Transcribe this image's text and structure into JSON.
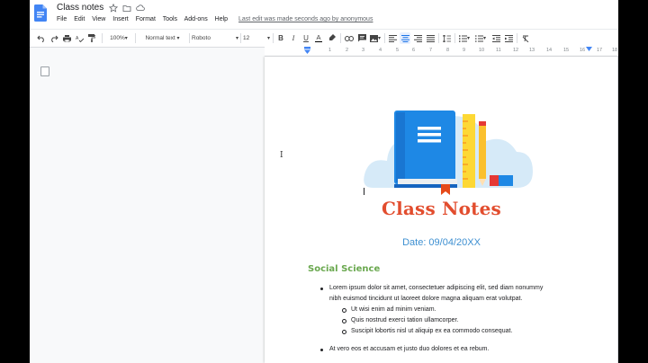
{
  "app": {
    "title": "Class notes",
    "menus": [
      "File",
      "Edit",
      "View",
      "Insert",
      "Format",
      "Tools",
      "Add-ons",
      "Help"
    ],
    "last_edit": "Last edit was made seconds ago by anonymous"
  },
  "toolbar": {
    "zoom": "100%",
    "style": "Normal text",
    "font": "Roboto",
    "font_size": "12"
  },
  "ruler": {
    "ticks": [
      "1",
      "2",
      "3",
      "4",
      "5",
      "6",
      "7",
      "8",
      "9",
      "10",
      "11",
      "12",
      "13",
      "14",
      "15",
      "16",
      "17",
      "18"
    ]
  },
  "document": {
    "heading": "Class Notes",
    "date": "Date: 09/04/20XX",
    "section_heading": "Social Science",
    "bullet1_line1": "Lorem ipsum dolor sit amet, consectetuer adipiscing elit, sed diam nonummy",
    "bullet1_line2": "nibh euismod tincidunt ut laoreet dolore magna aliquam erat volutpat.",
    "sub_items": [
      "Ut wisi enim ad minim veniam.",
      "Quis nostrud exerci tation ullamcorper.",
      "Suscipit lobortis nisl ut aliquip ex ea commodo consequat."
    ],
    "bullet2": "At vero eos et accusam et justo duo dolores et ea rebum."
  },
  "colors": {
    "heading": "#e24d2e",
    "date": "#3d8fd1",
    "section": "#6aa84f",
    "docs_blue": "#4285f4"
  }
}
